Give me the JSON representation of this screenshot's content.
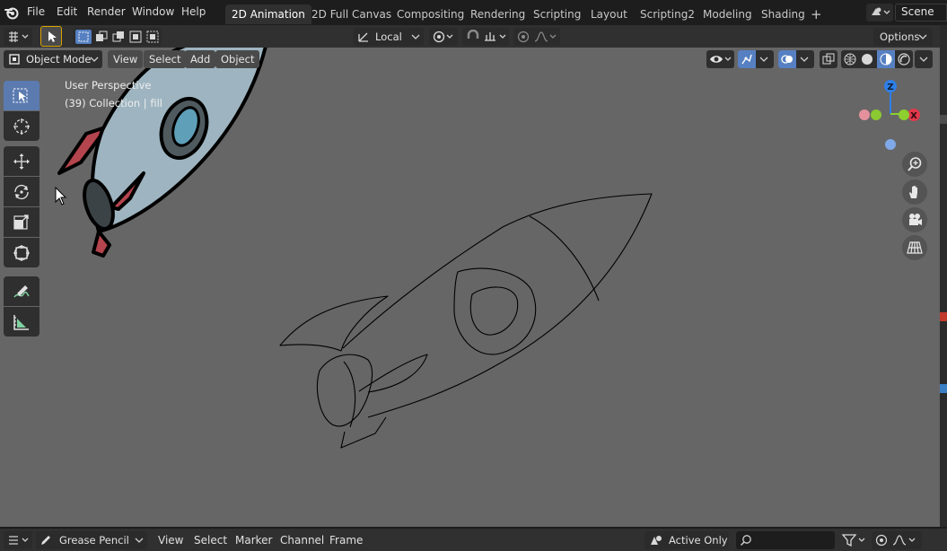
{
  "topbar": {
    "menus": [
      "File",
      "Edit",
      "Render",
      "Window",
      "Help"
    ],
    "workspaces": [
      "2D Animation",
      "2D Full Canvas",
      "Compositing",
      "Rendering",
      "Scripting",
      "Layout",
      "Scripting2",
      "Modeling",
      "Shading"
    ],
    "active_workspace": "2D Animation",
    "add_workspace": "+",
    "scene_label": "Scene"
  },
  "header": {
    "transform_orientation": "Local",
    "options_label": "Options"
  },
  "viewport": {
    "mode_label": "Object Mode",
    "menus": [
      "View",
      "Select",
      "Add",
      "Object"
    ],
    "overlay_line1": "User Perspective",
    "overlay_line2": "(39) Collection | fill",
    "gizmo": {
      "z_label": "Z",
      "x_label": "X"
    },
    "background_color": "#666666"
  },
  "bottombar": {
    "editor_label": "Grease Pencil",
    "menus": [
      "View",
      "Select",
      "Marker",
      "Channel",
      "Frame"
    ],
    "active_only_label": "Active Only",
    "search_placeholder": ""
  },
  "colors": {
    "accent_blue": "#5680c2",
    "rocket_body": "#9eb5c1",
    "rocket_fin": "#b4444d",
    "rocket_window": "#5fa0b8",
    "axis_x": "#e0394c",
    "axis_y": "#8ccf2e",
    "axis_z": "#2e7fe8"
  },
  "icons": {
    "blender_logo": "blender-logo-icon",
    "scene": "scene-icon",
    "tools": [
      "select-box-icon",
      "cursor-icon",
      "move-icon",
      "rotate-icon",
      "scale-icon",
      "transform-icon",
      "annotate-icon",
      "measure-icon"
    ],
    "nav": [
      "zoom-icon",
      "hand-icon",
      "camera-icon",
      "grid-icon"
    ]
  }
}
